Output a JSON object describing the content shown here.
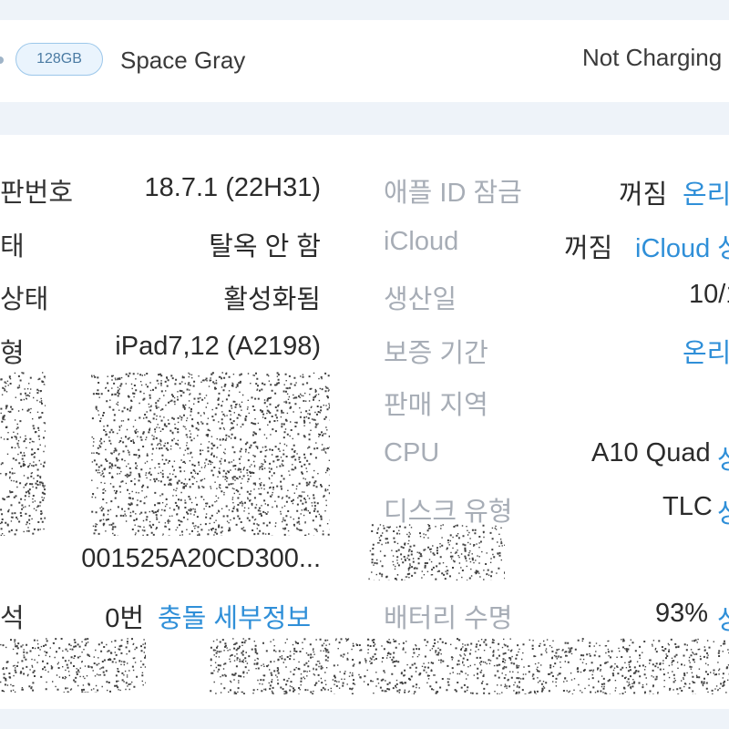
{
  "header": {
    "storage_badge": "128GB",
    "color": "Space Gray",
    "charging_status": "Not Charging"
  },
  "left_column": {
    "rows": [
      {
        "label": "판번호",
        "value": "18.7.1 (22H31)"
      },
      {
        "label": "태",
        "value": "탈옥 안 함"
      },
      {
        "label": "상태",
        "value": "활성화됨"
      },
      {
        "label": "형",
        "value": "iPad7,12 (A2198)"
      },
      {
        "label": "",
        "value": "001525A20CD300..."
      },
      {
        "label": "석",
        "value": "0번",
        "link": "충돌 세부정보"
      }
    ]
  },
  "right_column": {
    "rows": [
      {
        "label": "애플 ID 잠금",
        "value": "꺼짐",
        "link": "온리"
      },
      {
        "label": "iCloud",
        "value": "꺼짐",
        "link": "iCloud 상"
      },
      {
        "label": "생산일",
        "value": "10/1"
      },
      {
        "label": "보증 기간",
        "link": "온리"
      },
      {
        "label": "판매 지역"
      },
      {
        "label": "CPU",
        "value": "A10 Quad",
        "link": "상"
      },
      {
        "label": "디스크 유형",
        "value": "TLC",
        "link": "상"
      },
      {
        "label": "배터리 수명",
        "value": "93%",
        "link": "상"
      }
    ]
  }
}
